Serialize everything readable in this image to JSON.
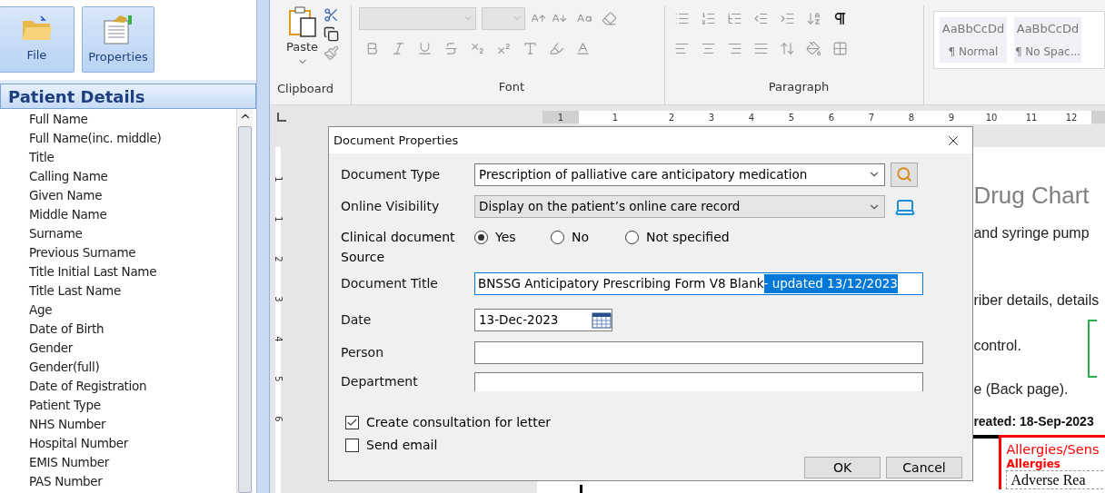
{
  "left_panel": {
    "toolbar": [
      {
        "label": "File",
        "kind": "folder"
      },
      {
        "label": "Properties",
        "kind": "document"
      }
    ],
    "section_title": "Patient Details",
    "fields": [
      "Full Name",
      "Full Name(inc. middle)",
      "Title",
      "Calling Name",
      "Given Name",
      "Middle Name",
      "Surname",
      "Previous Surname",
      "Title Initial Last Name",
      "Title Last Name",
      "Age",
      "Date of Birth",
      "Gender",
      "Gender(full)",
      "Date of Registration",
      "Patient Type",
      "NHS Number",
      "Hospital Number",
      "EMIS Number",
      "PAS Number"
    ]
  },
  "ribbon": {
    "paste_label": "Paste",
    "groups": [
      "Clipboard",
      "Font",
      "Paragraph"
    ],
    "styles": [
      {
        "preview": "AaBbCcDd",
        "name": "¶ Normal"
      },
      {
        "preview": "AaBbCcDd",
        "name": "¶ No Spac..."
      }
    ]
  },
  "ruler": {
    "marks": [
      "1",
      "1",
      "2",
      "3",
      "4",
      "5",
      "6",
      "7",
      "8",
      "9",
      "10",
      "11",
      "12"
    ]
  },
  "vertical_ruler": {
    "marks": [
      "1",
      "1",
      "2",
      "3",
      "4",
      "5",
      "6"
    ]
  },
  "document": {
    "title": "Drug Chart",
    "lines": [
      "and syringe pump",
      "riber details, details",
      "control.",
      "e (Back page)."
    ],
    "created": "reated: 18-Sep-2023",
    "allergy_heading": "Allergies/Sens",
    "allergy_sub": "Allergies",
    "table_lines": [
      "Adverse Rea"
    ]
  },
  "dialog": {
    "title": "Document Properties",
    "document_type": {
      "label": "Document Type",
      "value": "Prescription of palliative care anticipatory medication"
    },
    "online_visibility": {
      "label": "Online Visibility",
      "value": "Display on the patient’s online care record"
    },
    "source": {
      "label_lines": [
        "Clinical document",
        "Source"
      ],
      "options": [
        {
          "label": "Yes",
          "selected": true
        },
        {
          "label": "No",
          "selected": false
        },
        {
          "label": "Not specified",
          "selected": false
        }
      ]
    },
    "document_title": {
      "label": "Document Title",
      "value": "BNSSG Anticipatory Prescribing Form V8 Blank ",
      "selected_text": "- updated 13/12/2023"
    },
    "date": {
      "label": "Date",
      "value": "13-Dec-2023"
    },
    "person": {
      "label": "Person"
    },
    "department": {
      "label": "Department"
    },
    "checkboxes": [
      {
        "label": "Create consultation for letter",
        "checked": true
      },
      {
        "label": "Send email",
        "checked": false
      }
    ],
    "buttons": [
      "OK",
      "Cancel"
    ]
  }
}
